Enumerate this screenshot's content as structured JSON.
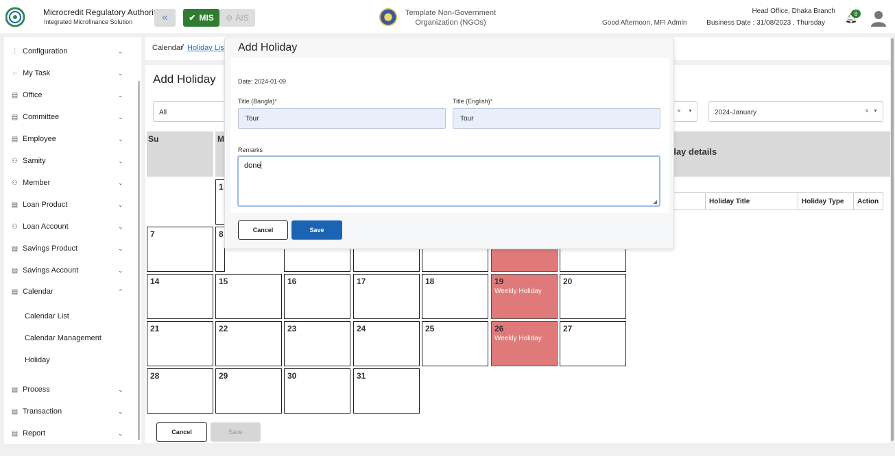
{
  "header": {
    "org_name": "Microcredit Regulatory Authority",
    "org_subtitle": "Integrated Microfinance Solution",
    "logo_text": "Microcredit Regulatory Authority",
    "mis_label": "MIS",
    "ais_label": "AIS",
    "center_line1": "Template Non-Government",
    "center_line2": "Organization (NGOs)",
    "greeting": "Good Afternoon, MFI Admin",
    "branch": "Head Office, Dhaka Branch",
    "business_date": "Business Date : 31/08/2023 , Thursday",
    "notification_count": "8",
    "brand_green": "#2e7d32",
    "accent_blue": "#1b63b3"
  },
  "sidebar": {
    "items": [
      {
        "label": "Configuration",
        "icon": "sliders-icon",
        "expanded": false
      },
      {
        "label": "My Task",
        "icon": "task-circle-icon",
        "expanded": false
      },
      {
        "label": "Office",
        "icon": "document-icon",
        "expanded": false
      },
      {
        "label": "Committee",
        "icon": "document-icon",
        "expanded": false
      },
      {
        "label": "Employee",
        "icon": "document-icon",
        "expanded": false
      },
      {
        "label": "Samity",
        "icon": "group-icon",
        "expanded": false
      },
      {
        "label": "Member",
        "icon": "group-icon",
        "expanded": false
      },
      {
        "label": "Loan Product",
        "icon": "document-icon",
        "expanded": false
      },
      {
        "label": "Loan Account",
        "icon": "group-icon",
        "expanded": false
      },
      {
        "label": "Savings Product",
        "icon": "document-icon",
        "expanded": false
      },
      {
        "label": "Savings Account",
        "icon": "document-icon",
        "expanded": false
      },
      {
        "label": "Calendar",
        "icon": "document-icon",
        "expanded": true
      },
      {
        "label": "Process",
        "icon": "document-icon",
        "expanded": false
      },
      {
        "label": "Transaction",
        "icon": "document-icon",
        "expanded": false
      },
      {
        "label": "Report",
        "icon": "document-icon",
        "expanded": false
      }
    ],
    "calendar_sub": [
      "Calendar List",
      "Calendar Management",
      "Holiday"
    ]
  },
  "breadcrumb": {
    "root": "Calendar",
    "separator": "/",
    "link": "Holiday List"
  },
  "page": {
    "title": "Add Holiday",
    "filter_all": "All",
    "filter_month": "2024-January",
    "clear_icon": "×",
    "details_title": "day details",
    "table_headers": [
      "Holiday Title",
      "Holiday Type",
      "Action"
    ],
    "cancel_label": "Cancel",
    "save_label": "Save"
  },
  "calendar": {
    "day_headers": [
      "Su",
      "M"
    ],
    "days": [
      {
        "n": "1",
        "event": ""
      },
      {
        "n": "7",
        "event": ""
      },
      {
        "n": "8",
        "event": ""
      },
      {
        "n": "14",
        "event": ""
      },
      {
        "n": "15",
        "event": ""
      },
      {
        "n": "16",
        "event": ""
      },
      {
        "n": "17",
        "event": ""
      },
      {
        "n": "18",
        "event": ""
      },
      {
        "n": "19",
        "event": "Weekly Holiday"
      },
      {
        "n": "20",
        "event": ""
      },
      {
        "n": "21",
        "event": ""
      },
      {
        "n": "22",
        "event": ""
      },
      {
        "n": "23",
        "event": ""
      },
      {
        "n": "24",
        "event": ""
      },
      {
        "n": "25",
        "event": ""
      },
      {
        "n": "26",
        "event": "Weekly Holiday"
      },
      {
        "n": "27",
        "event": ""
      },
      {
        "n": "28",
        "event": ""
      },
      {
        "n": "29",
        "event": ""
      },
      {
        "n": "30",
        "event": ""
      },
      {
        "n": "31",
        "event": ""
      }
    ],
    "holiday_color": "#e07a7a"
  },
  "modal": {
    "title": "Add Holiday",
    "date": "Date: 2024-01-09",
    "title_bangla_label": "Title (Bangla)",
    "title_english_label": "Title (English)",
    "required_mark": "*",
    "title_bangla_value": "Tour",
    "title_english_value": "Tour",
    "remarks_label": "Remarks",
    "remarks_value": "done",
    "cancel_label": "Cancel",
    "save_label": "Save"
  }
}
